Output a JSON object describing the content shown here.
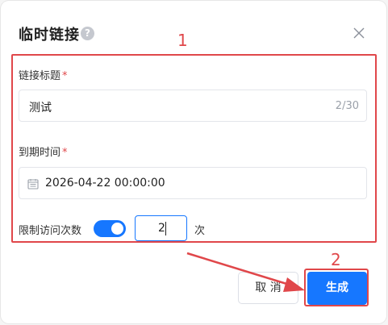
{
  "dialog": {
    "title": "临时链接",
    "help_icon": "question-circle-icon",
    "close_icon": "close-icon"
  },
  "form": {
    "link_title": {
      "label": "链接标题",
      "required_mark": "*",
      "value": "测试",
      "counter": "2/30"
    },
    "expire_time": {
      "label": "到期时间",
      "required_mark": "*",
      "icon": "calendar-icon",
      "value": "2026-04-22 00:00:00"
    },
    "limit_visits": {
      "label": "限制访问次数",
      "enabled": true,
      "count": "2",
      "unit": "次"
    }
  },
  "footer": {
    "cancel_label": "取 消",
    "confirm_label": "生成"
  },
  "annotations": {
    "marker_1": "1",
    "marker_2": "2",
    "color": "#e0474a"
  },
  "colors": {
    "accent": "#1677ff",
    "annotation": "#e0474a"
  }
}
